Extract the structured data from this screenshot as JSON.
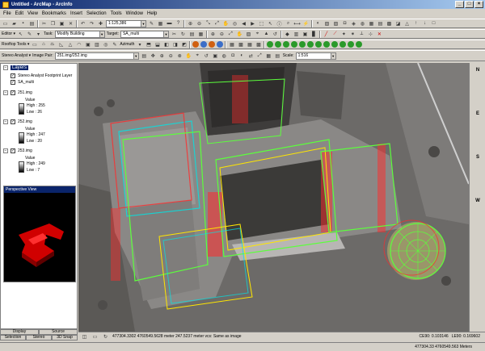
{
  "window": {
    "title": "Untitled - ArcMap - ArcInfo",
    "buttons": [
      "_",
      "□",
      "×"
    ]
  },
  "menu": [
    "File",
    "Edit",
    "View",
    "Bookmarks",
    "Insert",
    "Selection",
    "Tools",
    "Window",
    "Help"
  ],
  "standard_toolbar": {
    "scale": "1:125,386"
  },
  "editor_toolbar": {
    "editor_label": "Editor ▾",
    "task_label": "Task:",
    "task_value": "Modify Building",
    "target_label": "Target:",
    "target_value": "SA_multi"
  },
  "rooftop_toolbar": {
    "label": "Rooftop Tools ▾",
    "azimuth_label": "Azimuth"
  },
  "stereo_toolbar": {
    "label": "Stereo Analyst ▾",
    "image_pair_label": "Image Pair:",
    "image_pair_value": "251.img/252.img",
    "scale_label": "Scale:",
    "scale_value": "1:516"
  },
  "toc": {
    "root": "Layers",
    "layers": [
      {
        "name": "Stereo Analyst Footprint Layer"
      },
      {
        "name": "SA_multi"
      },
      {
        "name": "251.img",
        "value_label": "Value",
        "high": "High : 255",
        "low": "Low : 26"
      },
      {
        "name": "252.img",
        "value_label": "Value",
        "high": "High : 247",
        "low": "Low : 20"
      },
      {
        "name": "253.img",
        "value_label": "Value",
        "high": "High : 249",
        "low": "Low : 7"
      }
    ]
  },
  "perspective": {
    "title": "Perspective View"
  },
  "panel_tabs": [
    "Display",
    "Source",
    "Selection",
    "Stereo",
    "3D Snap"
  ],
  "map_status": {
    "coords": "477304.3302   4760549.5628 meter   247.5237 meter   vcs: Same as image",
    "ce90": "CE90: 0.103146",
    "le90": "LE90: 0.169602"
  },
  "statusbar": {
    "coords": "477304.33  4760549.563 Meters"
  },
  "compass": [
    "N",
    "E",
    "S",
    "W"
  ],
  "colors": {
    "title_start": "#0a246a",
    "title_end": "#a6caf0",
    "face": "#d4d0c8",
    "anaglyph_red": "#ff2a2a",
    "anaglyph_cyan": "#00e5e5",
    "roof_outline_green": "#5cff3c",
    "roof_outline_yellow": "#ffe600"
  }
}
